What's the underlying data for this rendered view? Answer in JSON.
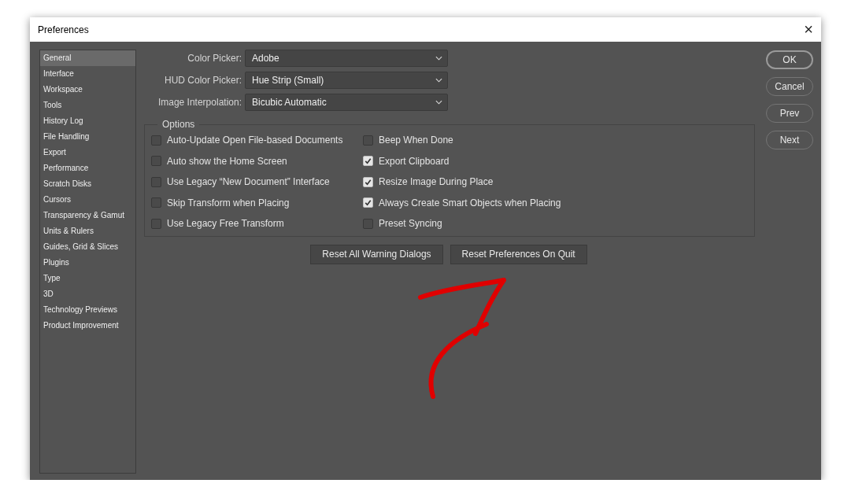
{
  "window": {
    "title": "Preferences",
    "close": "×"
  },
  "sidebar": {
    "items": [
      {
        "label": "General",
        "selected": true
      },
      {
        "label": "Interface",
        "selected": false
      },
      {
        "label": "Workspace",
        "selected": false
      },
      {
        "label": "Tools",
        "selected": false
      },
      {
        "label": "History Log",
        "selected": false
      },
      {
        "label": "File Handling",
        "selected": false
      },
      {
        "label": "Export",
        "selected": false
      },
      {
        "label": "Performance",
        "selected": false
      },
      {
        "label": "Scratch Disks",
        "selected": false
      },
      {
        "label": "Cursors",
        "selected": false
      },
      {
        "label": "Transparency & Gamut",
        "selected": false
      },
      {
        "label": "Units & Rulers",
        "selected": false
      },
      {
        "label": "Guides, Grid & Slices",
        "selected": false
      },
      {
        "label": "Plugins",
        "selected": false
      },
      {
        "label": "Type",
        "selected": false
      },
      {
        "label": "3D",
        "selected": false
      },
      {
        "label": "Technology Previews",
        "selected": false
      },
      {
        "label": "Product Improvement",
        "selected": false
      }
    ]
  },
  "fields": [
    {
      "label": "Color Picker:",
      "value": "Adobe"
    },
    {
      "label": "HUD Color Picker:",
      "value": "Hue Strip (Small)"
    },
    {
      "label": "Image Interpolation:",
      "value": "Bicubic Automatic"
    }
  ],
  "options": {
    "title": "Options",
    "items": [
      {
        "label": "Auto-Update Open File-based Documents",
        "checked": false
      },
      {
        "label": "Auto show the Home Screen",
        "checked": false
      },
      {
        "label": "Use Legacy “New Document” Interface",
        "checked": false
      },
      {
        "label": "Skip Transform when Placing",
        "checked": false
      },
      {
        "label": "Use Legacy Free Transform",
        "checked": false
      },
      {
        "label": "Beep When Done",
        "checked": false
      },
      {
        "label": "Export Clipboard",
        "checked": true
      },
      {
        "label": "Resize Image During Place",
        "checked": true
      },
      {
        "label": "Always Create Smart Objects when Placing",
        "checked": true
      },
      {
        "label": "Preset Syncing",
        "checked": false
      }
    ]
  },
  "reset_buttons": [
    "Reset All Warning Dialogs",
    "Reset Preferences On Quit"
  ],
  "side_buttons": [
    "OK",
    "Cancel",
    "Prev",
    "Next"
  ]
}
